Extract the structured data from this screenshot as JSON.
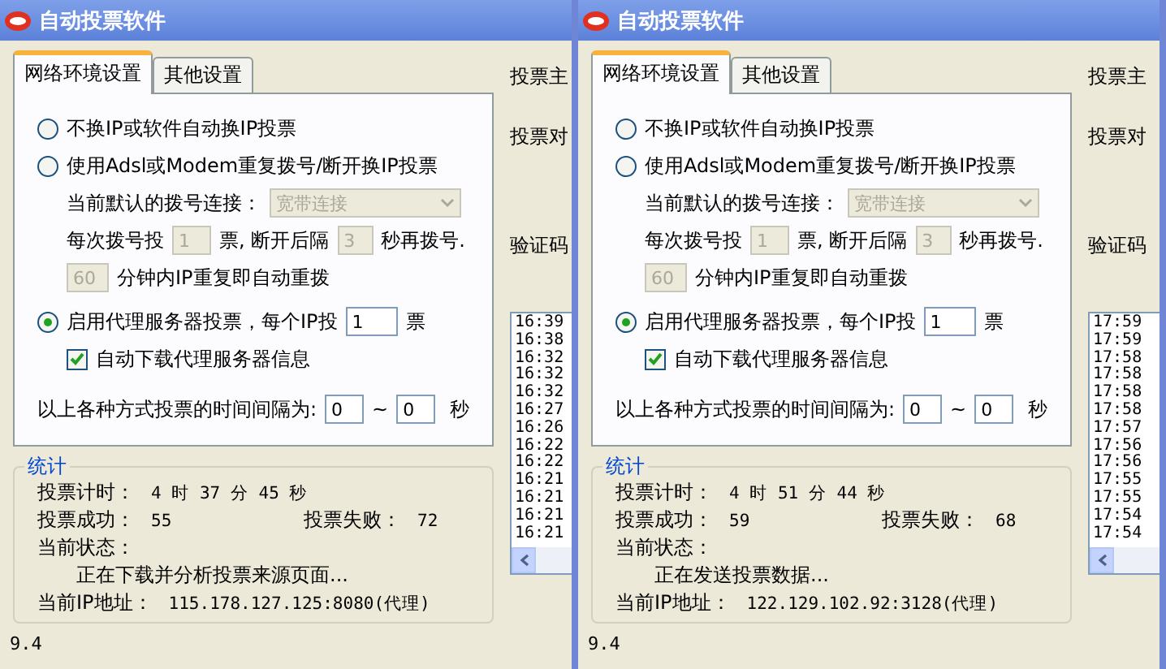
{
  "windows": [
    {
      "title": "自动投票软件",
      "tabs": [
        {
          "label": "网络环境设置",
          "selected": true
        },
        {
          "label": "其他设置",
          "selected": false
        }
      ],
      "modes": [
        {
          "label": "不换IP或软件自动换IP投票",
          "selected": false
        },
        {
          "label": "使用Adsl或Modem重复拨号/断开换IP投票",
          "selected": false
        },
        {
          "label": "启用代理服务器投票，每个IP投",
          "selected": true
        }
      ],
      "dial": {
        "disabled": true,
        "connection_label": "当前默认的拨号连接：",
        "connection_value": "宽带连接",
        "votes_label": "每次拨号投",
        "votes_value": "1",
        "mid_label": "票, 断开后隔",
        "seconds_value": "3",
        "end_label": "秒再拨号.",
        "minutes_value": "60",
        "minutes_label": "分钟内IP重复即自动重拨"
      },
      "proxy": {
        "votes_value": "1",
        "votes_unit": "票",
        "auto_download": {
          "label": "自动下载代理服务器信息",
          "checked": true
        }
      },
      "interval": {
        "label": "以上各种方式投票的时间间隔为:",
        "from": "0",
        "separator": "~",
        "to": "0",
        "unit": "秒"
      },
      "stats": {
        "title": "统计",
        "timer_label": "投票计时：",
        "timer": "4 时 37 分 45 秒",
        "success_label": "投票成功：",
        "success": "55",
        "fail_label": "投票失败：",
        "fail": "72",
        "status_label": "当前状态：",
        "status": "正在下载并分析投票来源页面...",
        "ip_label": "当前IP地址：",
        "ip": "115.178.127.125:8080(代理)"
      },
      "version": "9.4",
      "side_labels": [
        "投票主",
        "投票对",
        "验证码"
      ],
      "log": [
        "16:39",
        "16:38",
        "16:32",
        "16:32",
        "16:32",
        "16:27",
        "16:26",
        "16:22",
        "16:22",
        "16:21",
        "16:21",
        "16:21",
        "16:21"
      ]
    },
    {
      "title": "自动投票软件",
      "tabs": [
        {
          "label": "网络环境设置",
          "selected": true
        },
        {
          "label": "其他设置",
          "selected": false
        }
      ],
      "modes": [
        {
          "label": "不换IP或软件自动换IP投票",
          "selected": false
        },
        {
          "label": "使用Adsl或Modem重复拨号/断开换IP投票",
          "selected": false
        },
        {
          "label": "启用代理服务器投票，每个IP投",
          "selected": true
        }
      ],
      "dial": {
        "disabled": true,
        "connection_label": "当前默认的拨号连接：",
        "connection_value": "宽带连接",
        "votes_label": "每次拨号投",
        "votes_value": "1",
        "mid_label": "票, 断开后隔",
        "seconds_value": "3",
        "end_label": "秒再拨号.",
        "minutes_value": "60",
        "minutes_label": "分钟内IP重复即自动重拨"
      },
      "proxy": {
        "votes_value": "1",
        "votes_unit": "票",
        "auto_download": {
          "label": "自动下载代理服务器信息",
          "checked": true
        }
      },
      "interval": {
        "label": "以上各种方式投票的时间间隔为:",
        "from": "0",
        "separator": "~",
        "to": "0",
        "unit": "秒"
      },
      "stats": {
        "title": "统计",
        "timer_label": "投票计时：",
        "timer": "4 时 51 分 44 秒",
        "success_label": "投票成功：",
        "success": "59",
        "fail_label": "投票失败：",
        "fail": "68",
        "status_label": "当前状态：",
        "status": "正在发送投票数据...",
        "ip_label": "当前IP地址：",
        "ip": "122.129.102.92:3128(代理)"
      },
      "version": "9.4",
      "side_labels": [
        "投票主",
        "投票对",
        "验证码"
      ],
      "log": [
        "17:59",
        "17:59",
        "17:58",
        "17:58",
        "17:58",
        "17:58",
        "17:57",
        "17:56",
        "17:56",
        "17:55",
        "17:55",
        "17:54",
        "17:54"
      ]
    }
  ]
}
